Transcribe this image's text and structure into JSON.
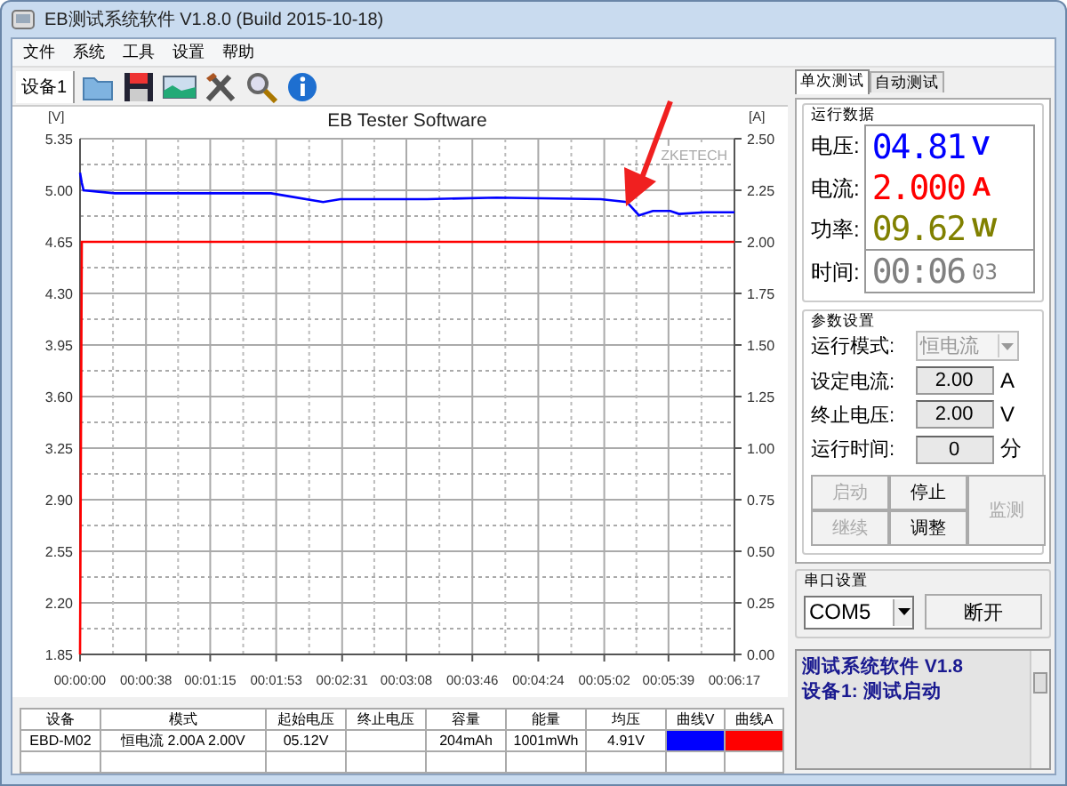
{
  "window": {
    "title": "EB测试系统软件 V1.8.0 (Build 2015-10-18)"
  },
  "menu": [
    "文件",
    "系统",
    "工具",
    "设置",
    "帮助"
  ],
  "toolbar": {
    "device_label": "设备1"
  },
  "chart": {
    "logo_text": "ZKETECH",
    "pointer": {
      "kind": "arrow"
    },
    "chart_data": {
      "type": "line",
      "grid": true,
      "title": "EB Tester Software",
      "ylabel": "[V]",
      "y2label": "[A]",
      "x": [
        0,
        1,
        2,
        20,
        60,
        110,
        120,
        140,
        150,
        200,
        240,
        300,
        315,
        322,
        330,
        340,
        345,
        360,
        377
      ],
      "xlim": [
        0,
        377
      ],
      "xticks": [
        {
          "value": 0,
          "label": "00:00:00"
        },
        {
          "value": 38,
          "label": "00:00:38"
        },
        {
          "value": 75,
          "label": "00:01:15"
        },
        {
          "value": 113,
          "label": "00:01:53"
        },
        {
          "value": 151,
          "label": "00:02:31"
        },
        {
          "value": 188,
          "label": "00:03:08"
        },
        {
          "value": 226,
          "label": "00:03:46"
        },
        {
          "value": 264,
          "label": "00:04:24"
        },
        {
          "value": 302,
          "label": "00:05:02"
        },
        {
          "value": 339,
          "label": "00:05:39"
        },
        {
          "value": 377,
          "label": "00:06:17"
        }
      ],
      "ylim": [
        1.85,
        5.35
      ],
      "yticks": [
        {
          "value": 1.85,
          "label": "1.85"
        },
        {
          "value": 2.2,
          "label": "2.20"
        },
        {
          "value": 2.55,
          "label": "2.55"
        },
        {
          "value": 2.9,
          "label": "2.90"
        },
        {
          "value": 3.25,
          "label": "3.25"
        },
        {
          "value": 3.6,
          "label": "3.60"
        },
        {
          "value": 3.95,
          "label": "3.95"
        },
        {
          "value": 4.3,
          "label": "4.30"
        },
        {
          "value": 4.65,
          "label": "4.65"
        },
        {
          "value": 5.0,
          "label": "5.00"
        },
        {
          "value": 5.35,
          "label": "5.35"
        }
      ],
      "y2lim": [
        0,
        2.5
      ],
      "y2ticks": [
        {
          "value": 0,
          "label": "0.00"
        },
        {
          "value": 0.25,
          "label": "0.25"
        },
        {
          "value": 0.5,
          "label": "0.50"
        },
        {
          "value": 0.75,
          "label": "0.75"
        },
        {
          "value": 1.0,
          "label": "1.00"
        },
        {
          "value": 1.25,
          "label": "1.25"
        },
        {
          "value": 1.5,
          "label": "1.50"
        },
        {
          "value": 1.75,
          "label": "1.75"
        },
        {
          "value": 2.0,
          "label": "2.00"
        },
        {
          "value": 2.25,
          "label": "2.25"
        },
        {
          "value": 2.5,
          "label": "2.50"
        }
      ],
      "series": [
        {
          "color": "#0000ff",
          "values": [
            5.12,
            5.05,
            5.0,
            4.98,
            4.98,
            4.98,
            4.96,
            4.92,
            4.94,
            4.94,
            4.95,
            4.94,
            4.92,
            4.83,
            4.86,
            4.86,
            4.84,
            4.85,
            4.85
          ]
        },
        {
          "color": "#ff0000",
          "axis": "y2",
          "values": [
            0,
            2,
            2,
            2,
            2,
            2,
            2,
            2,
            2,
            2,
            2,
            2,
            2,
            2,
            2,
            2,
            2,
            2,
            2
          ]
        }
      ]
    }
  },
  "table": {
    "columns": [
      "设备",
      "模式",
      "起始电压",
      "终止电压",
      "容量",
      "能量",
      "均压",
      "曲线V",
      "曲线A"
    ],
    "rows": [
      {
        "cells": [
          "EBD-M02",
          "恒电流  2.00A  2.00V",
          "05.12V",
          "",
          "204mAh",
          "1001mWh",
          "4.91V"
        ],
        "curves": [
          {
            "color": "#0000ff"
          },
          {
            "color": "#ff0000"
          }
        ]
      }
    ]
  },
  "tabs": [
    {
      "label": "单次测试",
      "selected": true
    },
    {
      "label": "自动测试",
      "selected": false
    }
  ],
  "readings": {
    "title": "运行数据",
    "items": [
      {
        "label": "电压:",
        "value": "04.81",
        "unit": "V",
        "color": "#0000ff"
      },
      {
        "label": "电流:",
        "value": "2.000",
        "unit": "A",
        "color": "#ff0000"
      },
      {
        "label": "功率:",
        "value": "09.62",
        "unit": "W",
        "color": "#808000"
      },
      {
        "label": "时间:",
        "value": "00:06",
        "unit": "03",
        "color": "#808080"
      }
    ]
  },
  "params": {
    "title": "参数设置",
    "fields": [
      {
        "kind": "select",
        "label": "运行模式:",
        "value": "恒电流",
        "disabled": true
      },
      {
        "kind": "input",
        "label": "设定电流:",
        "value": "2.00",
        "unit": "A"
      },
      {
        "kind": "input",
        "label": "终止电压:",
        "value": "2.00",
        "unit": "V"
      },
      {
        "kind": "input",
        "label": "运行时间:",
        "value": "0",
        "unit": "分"
      }
    ],
    "buttons": [
      {
        "label": "启动",
        "disabled": true
      },
      {
        "label": "停止",
        "disabled": false
      },
      {
        "label": "继续",
        "disabled": true
      },
      {
        "label": "调整",
        "disabled": false
      }
    ],
    "side_button": {
      "label": "监测",
      "disabled": true
    }
  },
  "serial": {
    "title": "串口设置",
    "port": "COM5",
    "button": "断开"
  },
  "log": [
    "测试系统软件 V1.8",
    "设备1: 测试启动"
  ]
}
